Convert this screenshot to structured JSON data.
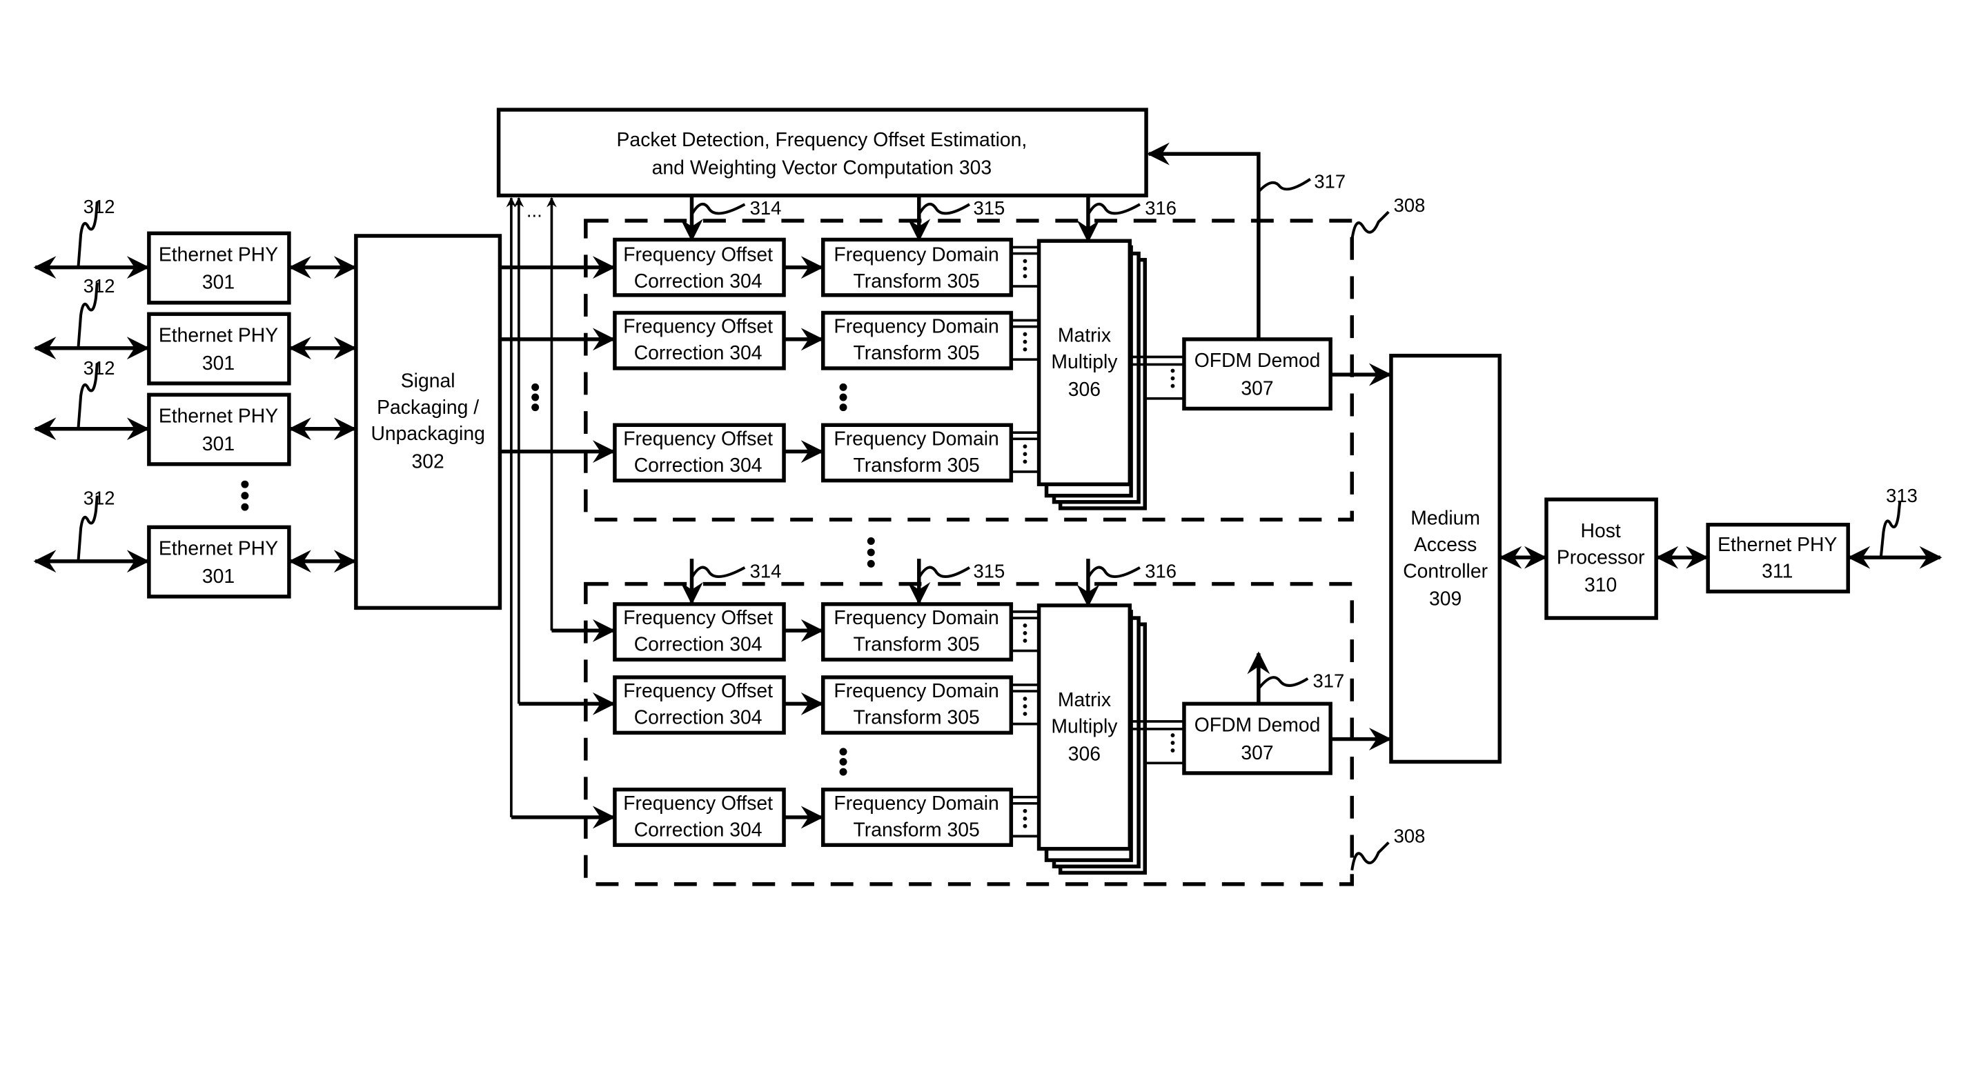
{
  "figure": {
    "blocks": {
      "eth_phy": [
        "Ethernet PHY",
        "301"
      ],
      "signal_pkg": [
        "Signal",
        "Packaging /",
        "Unpackaging",
        "302"
      ],
      "packet_detect": [
        "Packet Detection, Frequency Offset Estimation,",
        "and Weighting Vector Computation 303"
      ],
      "foc": [
        "Frequency Offset",
        "Correction 304"
      ],
      "fdt": [
        "Frequency Domain",
        "Transform 305"
      ],
      "matrix": [
        "Matrix",
        "Multiply",
        "306"
      ],
      "ofdm": [
        "OFDM Demod",
        "307"
      ],
      "mac": [
        "Medium",
        "Access",
        "Controller",
        "309"
      ],
      "host": [
        "Host",
        "Processor",
        "310"
      ],
      "eth_phy_out": [
        "Ethernet PHY",
        "311"
      ]
    },
    "refs": {
      "r312": "312",
      "r313": "313",
      "r314": "314",
      "r315": "315",
      "r316": "316",
      "r317": "317",
      "r308": "308",
      "ellipsis": "..."
    }
  }
}
